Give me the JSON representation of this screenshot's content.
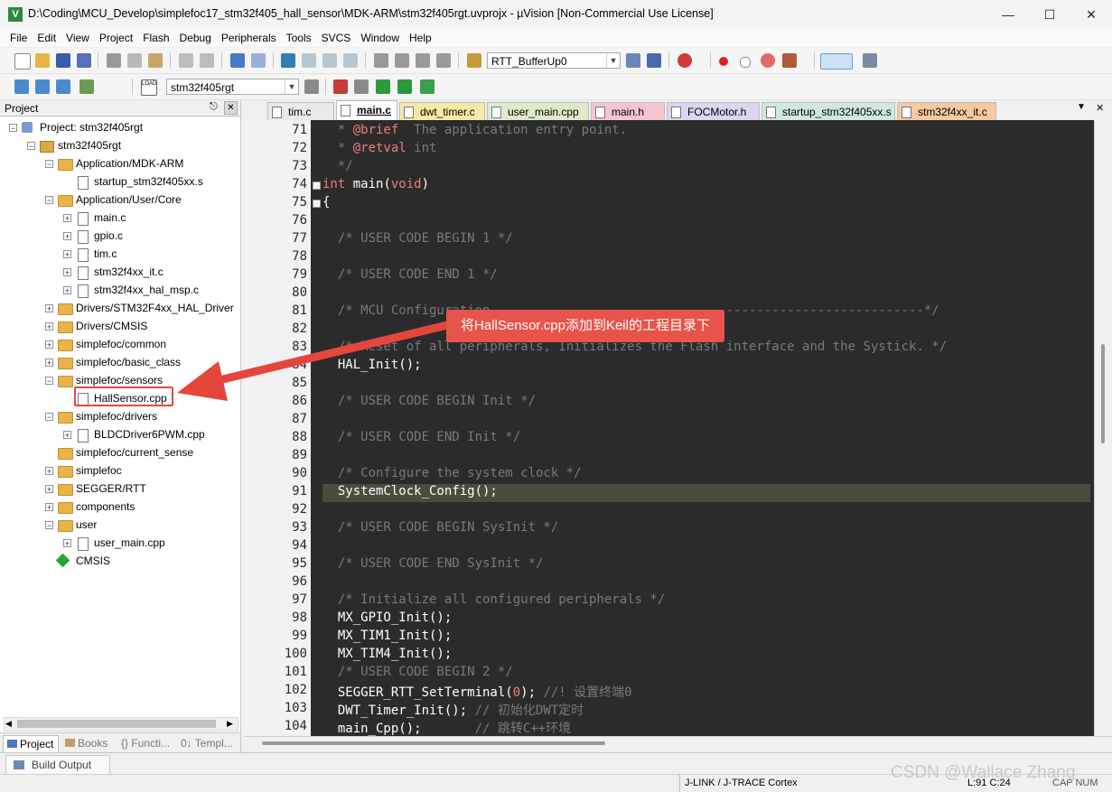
{
  "window": {
    "title": "D:\\Coding\\MCU_Develop\\simplefoc17_stm32f405_hall_sensor\\MDK-ARM\\stm32f405rgt.uvprojx - µVision  [Non-Commercial Use License]",
    "app_icon_glyph": "V"
  },
  "menubar": [
    "File",
    "Edit",
    "View",
    "Project",
    "Flash",
    "Debug",
    "Peripherals",
    "Tools",
    "SVCS",
    "Window",
    "Help"
  ],
  "toolbar1": {
    "target_combo": "RTT_BufferUp0"
  },
  "toolbar2": {
    "load_label": "LOAD",
    "project_combo": "stm32f405rgt"
  },
  "project_panel": {
    "title": "Project",
    "tree": [
      {
        "label": "Project: stm32f405rgt",
        "kind": "project"
      },
      {
        "label": "stm32f405rgt",
        "kind": "target"
      },
      {
        "label": "Application/MDK-ARM",
        "kind": "folder"
      },
      {
        "label": "startup_stm32f405xx.s",
        "kind": "file"
      },
      {
        "label": "Application/User/Core",
        "kind": "folder"
      },
      {
        "label": "main.c",
        "kind": "file"
      },
      {
        "label": "gpio.c",
        "kind": "file"
      },
      {
        "label": "tim.c",
        "kind": "file"
      },
      {
        "label": "stm32f4xx_it.c",
        "kind": "file"
      },
      {
        "label": "stm32f4xx_hal_msp.c",
        "kind": "file"
      },
      {
        "label": "Drivers/STM32F4xx_HAL_Driver",
        "kind": "folder"
      },
      {
        "label": "Drivers/CMSIS",
        "kind": "folder"
      },
      {
        "label": "simplefoc/common",
        "kind": "folder"
      },
      {
        "label": "simplefoc/basic_class",
        "kind": "folder"
      },
      {
        "label": "simplefoc/sensors",
        "kind": "folder"
      },
      {
        "label": "HallSensor.cpp",
        "kind": "file"
      },
      {
        "label": "simplefoc/drivers",
        "kind": "folder"
      },
      {
        "label": "BLDCDriver6PWM.cpp",
        "kind": "file"
      },
      {
        "label": "simplefoc/current_sense",
        "kind": "folder"
      },
      {
        "label": "simplefoc",
        "kind": "folder"
      },
      {
        "label": "SEGGER/RTT",
        "kind": "folder"
      },
      {
        "label": "components",
        "kind": "folder"
      },
      {
        "label": "user",
        "kind": "folder"
      },
      {
        "label": "user_main.cpp",
        "kind": "file"
      },
      {
        "label": "CMSIS",
        "kind": "component"
      }
    ],
    "bottom_tabs": [
      "Project",
      "Books",
      "{} Functi...",
      "0↓ Templ..."
    ]
  },
  "editor_tabs": [
    {
      "label": "tim.c",
      "color": "#e9e9e9"
    },
    {
      "label": "main.c",
      "color": "#ffffff",
      "active": true
    },
    {
      "label": "dwt_timer.c",
      "color": "#f6e9a6"
    },
    {
      "label": "user_main.cpp",
      "color": "#dfeacb"
    },
    {
      "label": "main.h",
      "color": "#f7c5d2"
    },
    {
      "label": "FOCMotor.h",
      "color": "#dcd5f0"
    },
    {
      "label": "startup_stm32f405xx.s",
      "color": "#cfe8e0"
    },
    {
      "label": "stm32f4xx_it.c",
      "color": "#f8c9a0"
    }
  ],
  "code_lines": [
    {
      "n": "71",
      "parts": [
        [
          "cm",
          "  * "
        ],
        [
          "kw",
          "@brief"
        ],
        [
          "cm",
          "  The application entry point."
        ]
      ]
    },
    {
      "n": "72",
      "parts": [
        [
          "cm",
          "  * "
        ],
        [
          "kw",
          "@retval"
        ],
        [
          "cm",
          " int"
        ]
      ]
    },
    {
      "n": "73",
      "parts": [
        [
          "cm",
          "  */"
        ]
      ]
    },
    {
      "n": "74",
      "parts": [
        [
          "kw",
          "int"
        ],
        [
          "tx",
          " main("
        ],
        [
          "kw",
          "void"
        ],
        [
          "tx",
          ")"
        ]
      ]
    },
    {
      "n": "75",
      "parts": [
        [
          "tx",
          "{"
        ]
      ]
    },
    {
      "n": "76",
      "parts": []
    },
    {
      "n": "77",
      "parts": [
        [
          "cm",
          "  /* USER CODE BEGIN 1 */"
        ]
      ]
    },
    {
      "n": "78",
      "parts": []
    },
    {
      "n": "79",
      "parts": [
        [
          "cm",
          "  /* USER CODE END 1 */"
        ]
      ]
    },
    {
      "n": "80",
      "parts": []
    },
    {
      "n": "81",
      "parts": [
        [
          "cm",
          "  /* MCU Configuration---------------------------------------------------------*/"
        ]
      ]
    },
    {
      "n": "82",
      "parts": []
    },
    {
      "n": "83",
      "parts": [
        [
          "cm",
          "  /* Reset of all peripherals, Initializes the Flash interface and the Systick. */"
        ]
      ]
    },
    {
      "n": "84",
      "parts": [
        [
          "tx",
          "  HAL_Init();"
        ]
      ]
    },
    {
      "n": "85",
      "parts": []
    },
    {
      "n": "86",
      "parts": [
        [
          "cm",
          "  /* USER CODE BEGIN Init */"
        ]
      ]
    },
    {
      "n": "87",
      "parts": []
    },
    {
      "n": "88",
      "parts": [
        [
          "cm",
          "  /* USER CODE END Init */"
        ]
      ]
    },
    {
      "n": "89",
      "parts": []
    },
    {
      "n": "90",
      "parts": [
        [
          "cm",
          "  /* Configure the system clock */"
        ]
      ]
    },
    {
      "n": "91",
      "parts": [
        [
          "tx",
          "  SystemClock_Config();"
        ]
      ]
    },
    {
      "n": "92",
      "parts": []
    },
    {
      "n": "93",
      "parts": [
        [
          "cm",
          "  /* USER CODE BEGIN SysInit */"
        ]
      ]
    },
    {
      "n": "94",
      "parts": []
    },
    {
      "n": "95",
      "parts": [
        [
          "cm",
          "  /* USER CODE END SysInit */"
        ]
      ]
    },
    {
      "n": "96",
      "parts": []
    },
    {
      "n": "97",
      "parts": [
        [
          "cm",
          "  /* Initialize all configured peripherals */"
        ]
      ]
    },
    {
      "n": "98",
      "parts": [
        [
          "tx",
          "  MX_GPIO_Init();"
        ]
      ]
    },
    {
      "n": "99",
      "parts": [
        [
          "tx",
          "  MX_TIM1_Init();"
        ]
      ]
    },
    {
      "n": "100",
      "parts": [
        [
          "tx",
          "  MX_TIM4_Init();"
        ]
      ]
    },
    {
      "n": "101",
      "parts": [
        [
          "cm",
          "  /* USER CODE BEGIN 2 */"
        ]
      ]
    },
    {
      "n": "102",
      "parts": [
        [
          "tx",
          "  SEGGER_RTT_SetTerminal("
        ],
        [
          "kw",
          "0"
        ],
        [
          "tx",
          "); "
        ],
        [
          "cm",
          "//! 设置终端0"
        ]
      ]
    },
    {
      "n": "103",
      "parts": [
        [
          "tx",
          "  DWT_Timer_Init(); "
        ],
        [
          "cm",
          "// 初始化DWT定时"
        ]
      ]
    },
    {
      "n": "104",
      "parts": [
        [
          "tx",
          "  main_Cpp();       "
        ],
        [
          "cm",
          "// 跳转C++环境"
        ]
      ]
    }
  ],
  "highlighted_line": "91",
  "annotation": {
    "callout_text": "将HallSensor.cpp添加到Keil的工程目录下"
  },
  "build_output": {
    "tab_label": "Build Output"
  },
  "statusbar": {
    "debugger": "J-LINK / J-TRACE Cortex",
    "position": "L:91 C:24",
    "caps": "CAP  NUM"
  },
  "watermark": "CSDN @Wallace Zhang"
}
